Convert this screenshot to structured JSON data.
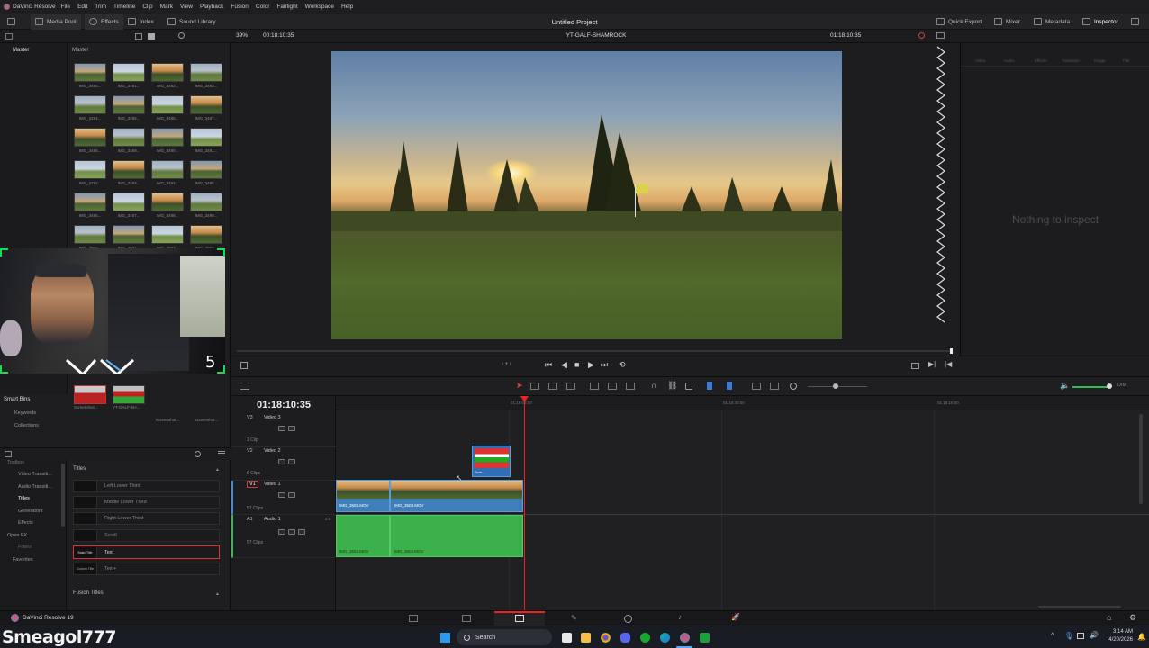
{
  "menubar": {
    "app_name": "DaVinci Resolve",
    "items": [
      "File",
      "Edit",
      "Trim",
      "Timeline",
      "Clip",
      "Mark",
      "View",
      "Playback",
      "Fusion",
      "Color",
      "Fairlight",
      "Workspace",
      "Help"
    ]
  },
  "toolbar": {
    "media_pool": "Media Pool",
    "effects": "Effects",
    "index": "Index",
    "sound_library": "Sound Library",
    "project_title": "Untitled Project",
    "quick_export": "Quick Export",
    "mixer": "Mixer",
    "metadata": "Metadata",
    "inspector": "Inspector"
  },
  "subbar": {
    "zoom": "39%",
    "source_timecode": "00:18:10:35",
    "timeline_name": "YT-GALF-SHAMROCK",
    "record_timecode": "01:18:10:35"
  },
  "media_pool": {
    "bin_master": "Master",
    "panel_master": "Master",
    "thumbnails": [
      "IMG_3480...",
      "IMG_3481...",
      "IMG_3482...",
      "IMG_3483...",
      "IMG_3484...",
      "IMG_3485...",
      "IMG_3486...",
      "IMG_3487...",
      "IMG_3488...",
      "IMG_3489...",
      "IMG_3490...",
      "IMG_3491...",
      "IMG_3492...",
      "IMG_3493...",
      "IMG_3494...",
      "IMG_3495...",
      "IMG_3496...",
      "IMG_3497...",
      "IMG_3498...",
      "IMG_3499...",
      "IMG_3500...",
      "IMG_3501...",
      "IMG_3502...",
      "IMG_3503..."
    ],
    "extra_thumbs": [
      "Screenshot...",
      "Screenshot...",
      "Screenshot..."
    ],
    "bottom_thumbs": [
      "Screenshot...",
      "YT-GALF-SH..."
    ],
    "smart_bins": "Smart Bins",
    "keywords": "Keywords",
    "collections": "Collections"
  },
  "webcam": {
    "overlay_number": "5"
  },
  "effects": {
    "tree": [
      "Toolbox",
      "Video Transiti...",
      "Audio Transiti...",
      "Titles",
      "Generators",
      "Effects",
      "Open FX",
      "Filters",
      "Favorites"
    ],
    "section_titles": "Titles",
    "title_items": [
      "Left Lower Third",
      "Middle Lower Third",
      "Right Lower Third",
      "Scroll",
      "Text",
      "Text+"
    ],
    "title_thumbs": [
      "Basic Title",
      "Custom Title"
    ],
    "section_fusion": "Fusion Titles"
  },
  "inspector": {
    "tabs": [
      "Video",
      "Audio",
      "Effects",
      "Transition",
      "Image",
      "File"
    ],
    "empty_message": "Nothing to inspect"
  },
  "timeline": {
    "timecode": "01:18:10:35",
    "ruler_ticks": [
      "01:18:08:00",
      "01:18:42:00",
      "01:18:16:00"
    ],
    "tracks": [
      {
        "id": "V3",
        "name": "Video 3",
        "clips": "1 Clip"
      },
      {
        "id": "V2",
        "name": "Video 2",
        "clips": "8 Clips"
      },
      {
        "id": "V1",
        "name": "Video 1",
        "clips": "57 Clips"
      },
      {
        "id": "A1",
        "name": "Audio 1",
        "clips": "57 Clips",
        "level": "2.0"
      }
    ],
    "video_clips": [
      "IMG_3503.MOV",
      "IMG_3503.MOV"
    ],
    "audio_clips": [
      "IMG_3503.MOV",
      "IMG_3503.MOV"
    ],
    "v2_clip": "Scre...",
    "audio_dim": "DIM"
  },
  "bottombar": {
    "app_version": "DaVinci Resolve 19"
  },
  "stream": {
    "username": "Smeagol777"
  },
  "taskbar": {
    "search": "Search",
    "time": "3:14 AM",
    "date": "4/20/2026"
  }
}
